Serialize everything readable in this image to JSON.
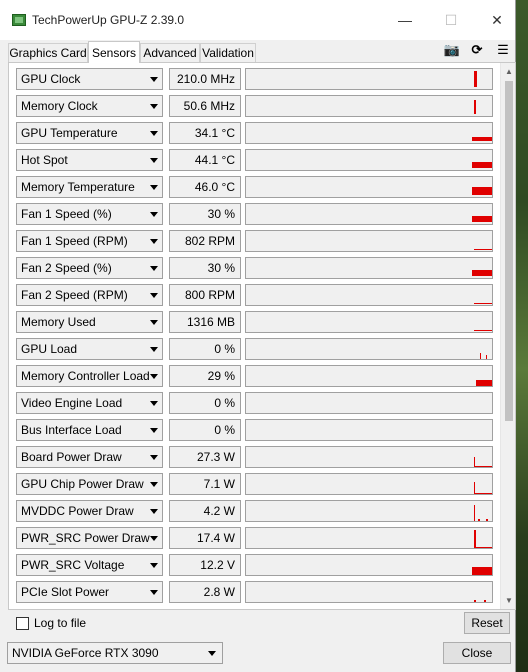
{
  "window": {
    "title": "TechPowerUp GPU-Z 2.39.0",
    "minimize": "—",
    "maximize": "☐",
    "close": "✕"
  },
  "tabs": [
    {
      "label": "Graphics Card",
      "active": false
    },
    {
      "label": "Sensors",
      "active": true
    },
    {
      "label": "Advanced",
      "active": false
    },
    {
      "label": "Validation",
      "active": false
    }
  ],
  "toolbar": {
    "camera_icon": "📷",
    "refresh_icon": "⟳",
    "menu_icon": "☰"
  },
  "sensors": [
    {
      "label": "GPU Clock",
      "value": "210.0 MHz"
    },
    {
      "label": "Memory Clock",
      "value": "50.6 MHz"
    },
    {
      "label": "GPU Temperature",
      "value": "34.1 °C"
    },
    {
      "label": "Hot Spot",
      "value": "44.1 °C"
    },
    {
      "label": "Memory Temperature",
      "value": "46.0 °C"
    },
    {
      "label": "Fan 1 Speed (%)",
      "value": "30 %"
    },
    {
      "label": "Fan 1 Speed (RPM)",
      "value": "802 RPM"
    },
    {
      "label": "Fan 2 Speed (%)",
      "value": "30 %"
    },
    {
      "label": "Fan 2 Speed (RPM)",
      "value": "800 RPM"
    },
    {
      "label": "Memory Used",
      "value": "1316 MB"
    },
    {
      "label": "GPU Load",
      "value": "0 %"
    },
    {
      "label": "Memory Controller Load",
      "value": "29 %"
    },
    {
      "label": "Video Engine Load",
      "value": "0 %"
    },
    {
      "label": "Bus Interface Load",
      "value": "0 %"
    },
    {
      "label": "Board Power Draw",
      "value": "27.3 W"
    },
    {
      "label": "GPU Chip Power Draw",
      "value": "7.1 W"
    },
    {
      "label": "MVDDC Power Draw",
      "value": "4.2 W"
    },
    {
      "label": "PWR_SRC Power Draw",
      "value": "17.4 W"
    },
    {
      "label": "PWR_SRC Voltage",
      "value": "12.2 V"
    },
    {
      "label": "PCIe Slot Power",
      "value": "2.8 W"
    }
  ],
  "graph_color": "#e00000",
  "scrollbar": {
    "up": "▲",
    "down": "▼"
  },
  "bottom": {
    "log_to_file_label": "Log to file",
    "log_to_file_checked": false,
    "reset_label": "Reset"
  },
  "footer": {
    "gpu_name": "NVIDIA GeForce RTX 3090",
    "close_label": "Close"
  }
}
